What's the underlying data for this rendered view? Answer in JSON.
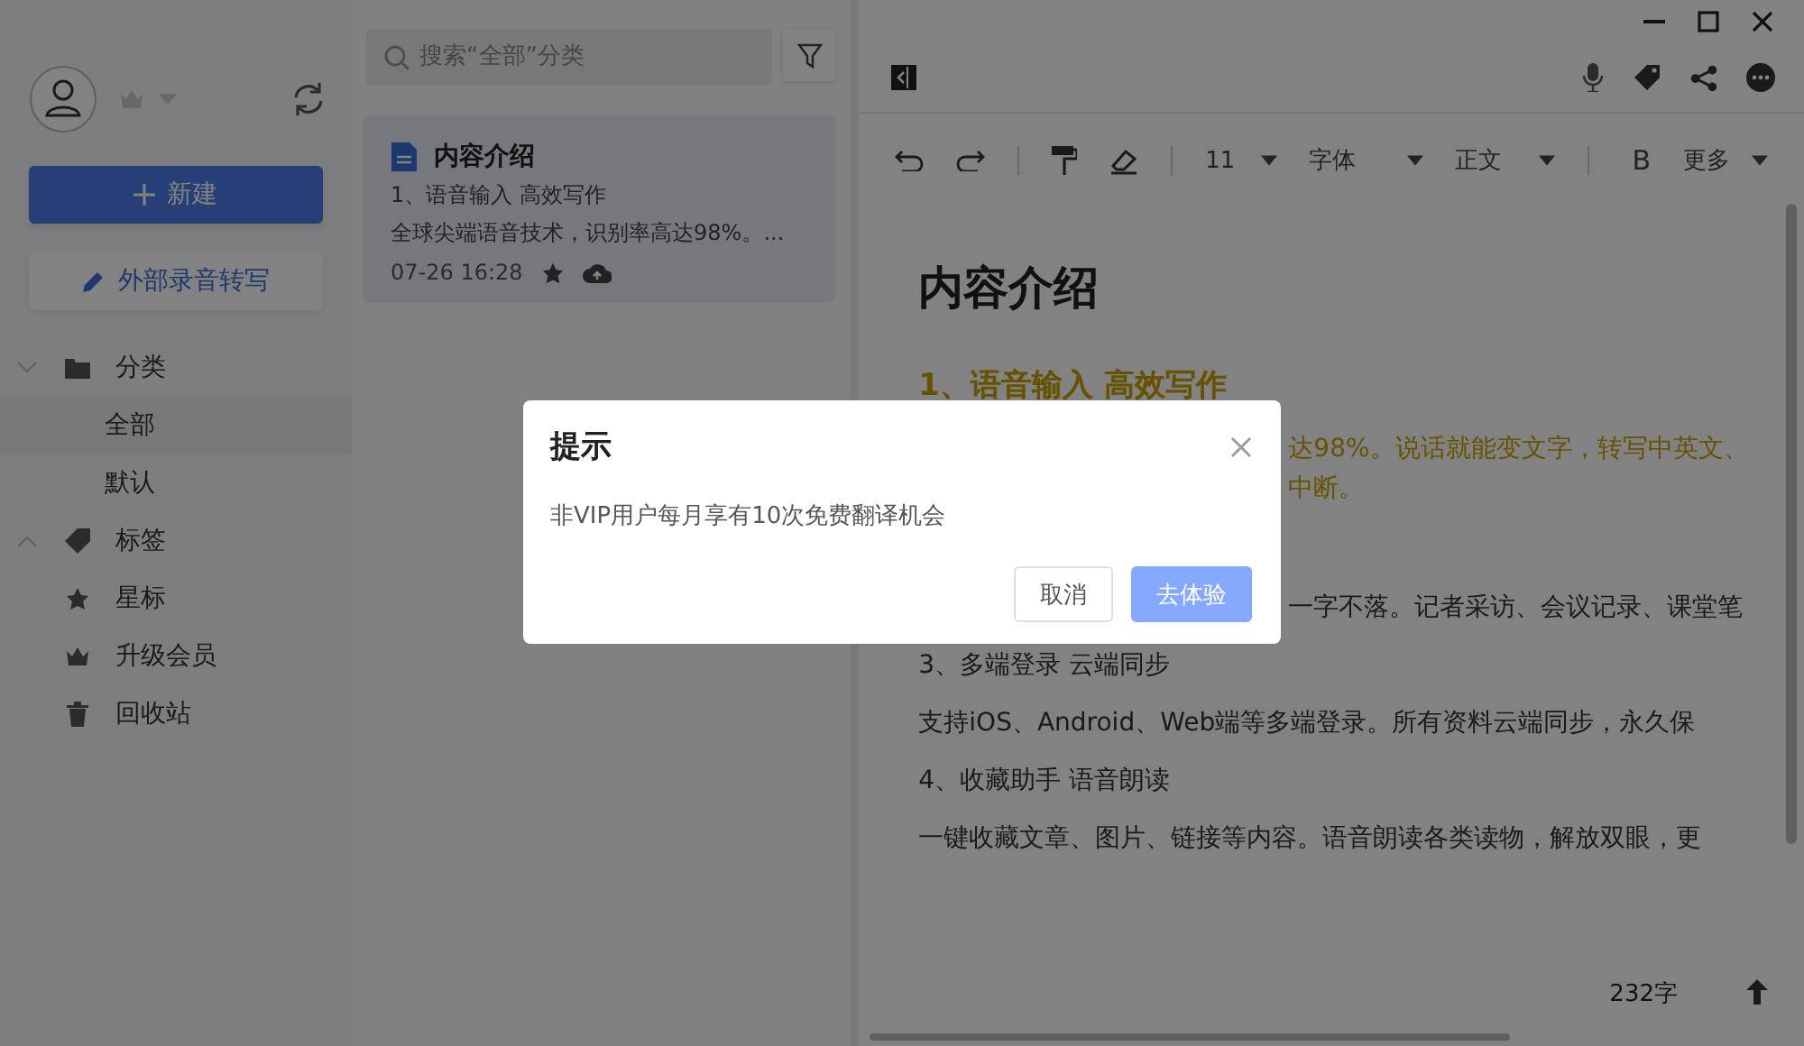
{
  "sidebar": {
    "new_button": "新建",
    "import_button": "外部录音转写",
    "nav": [
      {
        "kind": "group",
        "label": "分类",
        "expanded": true,
        "children": [
          {
            "label": "全部",
            "selected": true
          },
          {
            "label": "默认",
            "selected": false
          }
        ]
      },
      {
        "kind": "group",
        "label": "标签",
        "expanded": false
      },
      {
        "kind": "item",
        "label": "星标"
      },
      {
        "kind": "item",
        "label": "升级会员"
      },
      {
        "kind": "item",
        "label": "回收站"
      }
    ]
  },
  "note_list": {
    "search": {
      "placeholder": "搜索“全部”分类"
    },
    "notes": [
      {
        "title": "内容介绍",
        "line_1": "1、语音输入 高效写作",
        "line_2": "全球尖端语音技术，识别率高达98%。...",
        "time": "07-26 16:28",
        "selected": true
      }
    ]
  },
  "editor": {
    "toolbar": {
      "font_size": "11",
      "font": "字体",
      "style": "正文",
      "bold": "B",
      "more": "更多"
    },
    "title": "内容介绍",
    "blocks": [
      {
        "kind": "heading",
        "text": "1、语音输入 高效写作"
      },
      {
        "kind": "partial-highlight",
        "text": "达98%。说话就能变文字，转写中英文、"
      },
      {
        "kind": "partial-highlight",
        "text": "中断。"
      },
      {
        "kind": "partial",
        "text": "一字不落。记者采访、会议记录、课堂笔"
      },
      {
        "kind": "subheading",
        "text": "3、多端登录 云端同步"
      },
      {
        "kind": "paragraph",
        "text": "支持iOS、Android、Web端等多端登录。所有资料云端同步，永久保"
      },
      {
        "kind": "subheading",
        "text": "4、收藏助手 语音朗读"
      },
      {
        "kind": "paragraph",
        "text": "一键收藏文章、图片、链接等内容。语音朗读各类读物，解放双眼，更"
      }
    ],
    "word_count": "232字"
  },
  "dialog": {
    "title": "提示",
    "message": "非VIP用户每月享有10次免费翻译机会",
    "cancel": "取消",
    "confirm": "去体验"
  }
}
